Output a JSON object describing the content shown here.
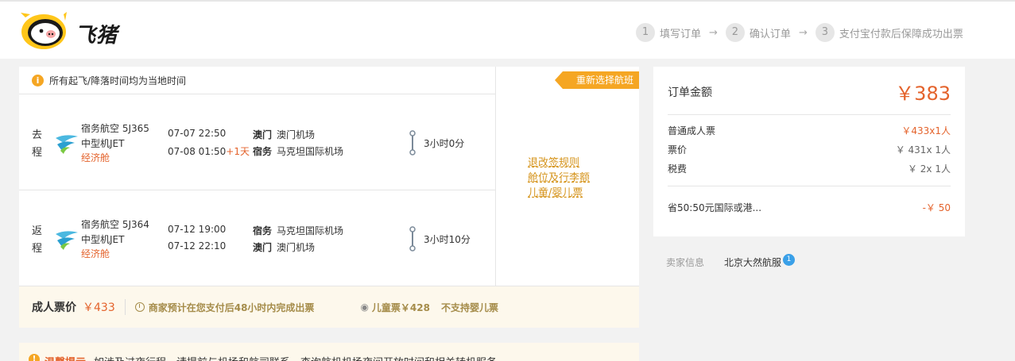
{
  "header": {
    "logo_text": "飞猪",
    "steps": [
      {
        "num": "1",
        "label": "填写订单"
      },
      {
        "num": "2",
        "label": "确认订单"
      },
      {
        "num": "3",
        "label": "支付宝付款后保障成功出票"
      }
    ],
    "step_arrow": "→"
  },
  "flight": {
    "notice": "所有起飞/降落时间均为当地时间",
    "reselect_label": "重新选择航班",
    "outbound": {
      "direction": "去程",
      "airline": "宿务航空",
      "flight_no": "5J365",
      "aircraft": "中型机JET",
      "cabin": "经济舱",
      "depart_time": "07-07 22:50",
      "arrive_time": "07-08 01:50",
      "plus_day": "+1天",
      "depart_city": "澳门",
      "depart_airport": "澳门机场",
      "arrive_city": "宿务",
      "arrive_airport": "马克坦国际机场",
      "duration": "3小时0分"
    },
    "inbound": {
      "direction": "返程",
      "airline": "宿务航空",
      "flight_no": "5J364",
      "aircraft": "中型机JET",
      "cabin": "经济舱",
      "depart_time": "07-12 19:00",
      "arrive_time": "07-12 22:10",
      "depart_city": "宿务",
      "depart_airport": "马克坦国际机场",
      "arrive_city": "澳门",
      "arrive_airport": "澳门机场",
      "duration": "3小时10分"
    },
    "policy_links": [
      "退改签规则",
      "舱位及行李额",
      "儿童/婴儿票"
    ],
    "price_bar": {
      "label": "成人票价",
      "price": "￥433",
      "issue_note": "商家预计在您支付后48小时内完成出票",
      "child_price": "儿童票￥428",
      "no_infant": "不支持婴儿票"
    },
    "tips": {
      "label": "温馨提示",
      "text": "如涉及过夜行程，请提前与机场和航司联系，查询航机机场夜间开放时间和相关转机服务"
    }
  },
  "order": {
    "title": "订单金额",
    "total": "￥383",
    "rows": [
      {
        "label": "普通成人票",
        "value": "￥433x1人"
      },
      {
        "label": "票价",
        "value": "￥ 431x 1人"
      },
      {
        "label": "税费",
        "value": "￥ 2x 1人"
      }
    ],
    "discount": {
      "label": "省50:50元国际或港...",
      "value": "-￥ 50"
    }
  },
  "seller": {
    "label": "卖家信息",
    "name": "北京大然航服",
    "badge": "1"
  },
  "colors": {
    "accent_orange": "#e4632c",
    "tag_orange": "#f5a623",
    "link_gold": "#d5931a",
    "badge_blue": "#3aa0e8"
  }
}
